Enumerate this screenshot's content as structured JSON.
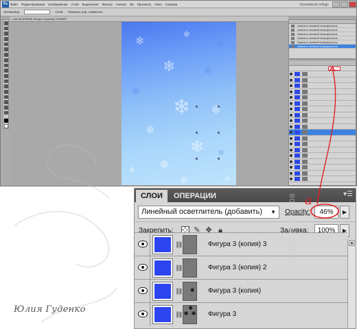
{
  "app": {
    "logo": "Ps",
    "menu": [
      "Файл",
      "Редактирование",
      "Изображение",
      "Слой",
      "Выделение",
      "Фильтр",
      "Анализ",
      "3D",
      "Просмотр",
      "Окно",
      "Справка"
    ],
    "title_right": "ОСНОВНАЯ СРЕДА"
  },
  "options_bar": {
    "items": [
      "Автовыбор:",
      "Слой",
      "Показать упр. элементы"
    ]
  },
  "document_tab": {
    "title": "Lard 46 (RGB/8) Фигура 3 (копия) 3 RGB/8*"
  },
  "history": {
    "rows": [
      "Изменить основной непрозрачность",
      "Изменить основной непрозрачность",
      "Изменить основной непрозрачность",
      "Изменить основной непрозрачность",
      "Изменить основной непрозрачность",
      "Изменить основной непрозрачность"
    ],
    "selected_index": 5
  },
  "layers_panel": {
    "tab_layers": "СЛОИ",
    "tab_channels": "ОПЕРАЦИИ",
    "menu_icon": "panel-menu-icon",
    "blend_mode": "Линейный осветлитель (добавить)",
    "opacity_label": "Opacity:",
    "opacity_value": "46%",
    "lock_label": "Закрепить:",
    "fill_label": "Заливка:",
    "fill_value": "100%",
    "layers": [
      {
        "name": "Фигура 3 (копия) 3",
        "mask_marks": "",
        "visible": true
      },
      {
        "name": "Фигура 3 (копия) 2",
        "mask_marks": "·  ·\n   ·",
        "visible": true
      },
      {
        "name": "Фигура 3 (копия)",
        "mask_marks": "\n·  ✱\n ·",
        "visible": true
      },
      {
        "name": "Фигура 3",
        "mask_marks": " ✱\n✱  ✱",
        "visible": true
      }
    ]
  },
  "annotation": {
    "letter": "a"
  },
  "signature": "Юлия Гуденко",
  "site_watermark": "Страна Мастеров",
  "colors": {
    "layer_thumb_blue": "#2d44f0",
    "annotation_red": "#e02020",
    "panel_bg": "#d6d6d6",
    "selection_blue": "#3d82e0"
  }
}
